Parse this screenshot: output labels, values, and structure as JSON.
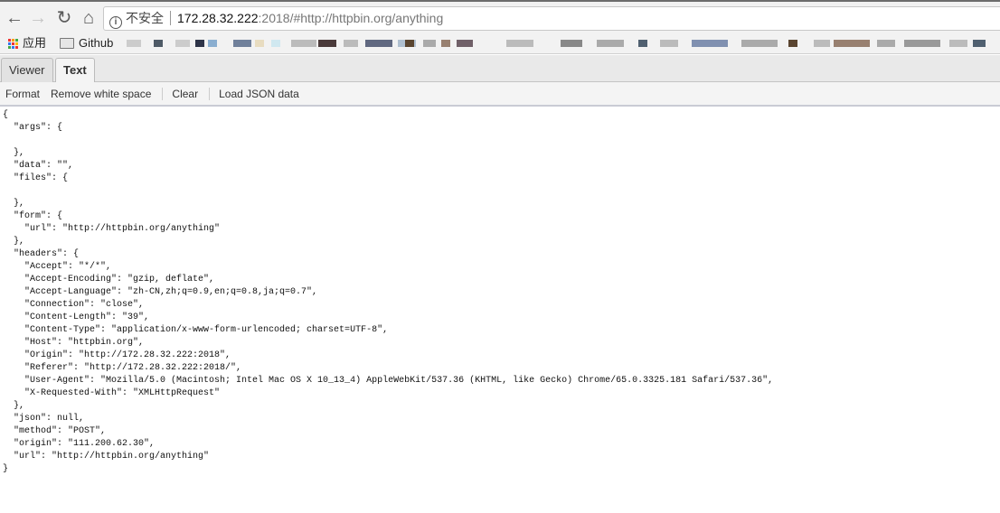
{
  "browser": {
    "nav": {
      "back": "back-icon",
      "forward": "forward-icon",
      "reload": "reload-icon",
      "home": "home-icon"
    },
    "address": {
      "security_label": "不安全",
      "host": "172.28.32.222",
      "rest": ":2018/#http://httpbin.org/anything"
    },
    "bookmarks": [
      {
        "label": "应用",
        "icon": "apps-grid-icon"
      },
      {
        "label": "Github",
        "icon": "folder-icon"
      }
    ]
  },
  "tabs": [
    {
      "label": "Viewer",
      "active": false
    },
    {
      "label": "Text",
      "active": true
    }
  ],
  "toolbar": {
    "format": "Format",
    "remove_ws": "Remove white space",
    "clear": "Clear",
    "load": "Load JSON data"
  },
  "editor": {
    "text": "{\n  \"args\": {\n\n  },\n  \"data\": \"\",\n  \"files\": {\n\n  },\n  \"form\": {\n    \"url\": \"http://httpbin.org/anything\"\n  },\n  \"headers\": {\n    \"Accept\": \"*/*\",\n    \"Accept-Encoding\": \"gzip, deflate\",\n    \"Accept-Language\": \"zh-CN,zh;q=0.9,en;q=0.8,ja;q=0.7\",\n    \"Connection\": \"close\",\n    \"Content-Length\": \"39\",\n    \"Content-Type\": \"application/x-www-form-urlencoded; charset=UTF-8\",\n    \"Host\": \"httpbin.org\",\n    \"Origin\": \"http://172.28.32.222:2018\",\n    \"Referer\": \"http://172.28.32.222:2018/\",\n    \"User-Agent\": \"Mozilla/5.0 (Macintosh; Intel Mac OS X 10_13_4) AppleWebKit/537.36 (KHTML, like Gecko) Chrome/65.0.3325.181 Safari/537.36\",\n    \"X-Requested-With\": \"XMLHttpRequest\"\n  },\n  \"json\": null,\n  \"method\": \"POST\",\n  \"origin\": \"111.200.62.30\",\n  \"url\": \"http://httpbin.org/anything\"\n}"
  }
}
